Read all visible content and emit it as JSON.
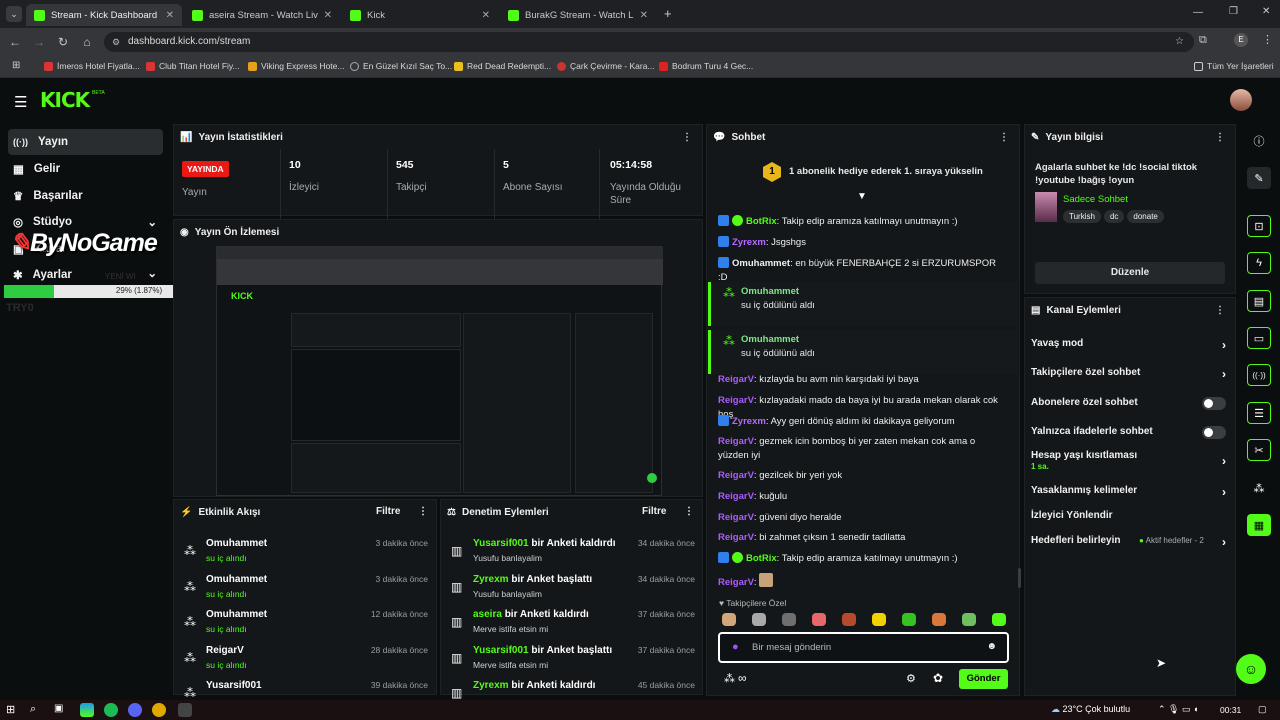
{
  "browser": {
    "tabs": [
      {
        "title": "Stream - Kick Dashboard"
      },
      {
        "title": "aseira Stream - Watch Live on K"
      },
      {
        "title": "Kick"
      },
      {
        "title": "BurakG Stream - Watch Live on"
      }
    ],
    "url": "dashboard.kick.com/stream",
    "bookmarks": [
      "İmeros Hotel Fiyatla...",
      "Club Titan Hotel Fiy...",
      "Viking Express Hote...",
      "En Güzel Kızıl Saç To...",
      "Red Dead Redempti...",
      "Çark Çevirme - Kara...",
      "Bodrum Turu 4 Gec..."
    ],
    "all_bookmarks": "Tüm Yer İşaretleri"
  },
  "kick": {
    "logo": "KICK",
    "beta": "BETA"
  },
  "sidebar": {
    "items": [
      {
        "label": "Yayın"
      },
      {
        "label": "Gelir"
      },
      {
        "label": "Başarılar"
      },
      {
        "label": "Stüdyo"
      },
      {
        "label": "Kanal"
      },
      {
        "label": "Ayarlar"
      }
    ],
    "watermark": "ByNoGame",
    "watermark_sub": "YENİ WI",
    "progress": {
      "label": "29% (1.87%)",
      "fraction": 0.0187
    },
    "ghost_text": "TRY0"
  },
  "stats": {
    "title": "Yayın İstatistikleri",
    "live_badge": "YAYINDA",
    "live_label": "Yayın",
    "viewers": {
      "value": "10",
      "label": "İzleyici"
    },
    "followers": {
      "value": "545",
      "label": "Takipçi"
    },
    "subs": {
      "value": "5",
      "label": "Abone Sayısı"
    },
    "uptime": {
      "value": "05:14:58",
      "label": "Yayında Olduğu Süre"
    }
  },
  "preview": {
    "title": "Yayın Ön İzlemesi"
  },
  "activity": {
    "title": "Etkinlik Akışı",
    "filter": "Filtre",
    "items": [
      {
        "name": "Omuhammet",
        "sub": "su iç alındı",
        "time": "3 dakika önce"
      },
      {
        "name": "Omuhammet",
        "sub": "su iç alındı",
        "time": "3 dakika önce"
      },
      {
        "name": "Omuhammet",
        "sub": "su iç alındı",
        "time": "12 dakika önce"
      },
      {
        "name": "ReigarV",
        "sub": "su iç alındı",
        "time": "28 dakika önce"
      },
      {
        "name": "Yusarsif001",
        "sub": "",
        "time": "39 dakika önce"
      }
    ]
  },
  "moderation": {
    "title": "Denetim Eylemleri",
    "filter": "Filtre",
    "items": [
      {
        "user": "Yusarsif001",
        "action": "bir Anketi kaldırdı",
        "sub": "Yusufu banlayalim",
        "time": "34 dakika önce"
      },
      {
        "user": "Zyrexm",
        "action": "bir Anket başlattı",
        "sub": "Yusufu banlayalim",
        "time": "34 dakika önce"
      },
      {
        "user": "aseira",
        "action": "bir Anketi kaldırdı",
        "sub": "Merve istifa etsin mi",
        "time": "37 dakika önce"
      },
      {
        "user": "Yusarsif001",
        "action": "bir Anket başlattı",
        "sub": "Merve istifa etsin mi",
        "time": "37 dakika önce"
      },
      {
        "user": "Zyrexm",
        "action": "bir Anketi kaldırdı",
        "sub": "",
        "time": "45 dakika önce"
      }
    ]
  },
  "chat": {
    "title": "Sohbet",
    "pinned": "1 abonelik hediye ederek 1. sıraya yükselin",
    "pinned_rank": "1",
    "messages": [
      {
        "user": "BotRix",
        "text": "Takip edip aramıza katılmayı unutmayın :)"
      },
      {
        "user": "Zyrexm",
        "text": "Jsgshgs"
      },
      {
        "user": "Omuhammet",
        "text": "en büyük FENERBAHÇE 2 si ERZURUMSPOR :D"
      }
    ],
    "rewards": [
      {
        "user": "Omuhammet",
        "text": "su iç ödülünü aldı"
      },
      {
        "user": "Omuhammet",
        "text": "su iç ödülünü aldı"
      }
    ],
    "messages2": [
      {
        "user": "ReigarV",
        "text": "kızlayda bu avm nin karşıdaki iyi baya"
      },
      {
        "user": "ReigarV",
        "text": "kızlayadaki mado da baya iyi bu arada mekan olarak cok hoş"
      },
      {
        "user": "Zyrexm",
        "text": "Ayy geri dönüş aldım iki dakikaya geliyorum"
      },
      {
        "user": "ReigarV",
        "text": "gezmek icin bomboş bi yer zaten mekan cok ama o yüzden iyi"
      },
      {
        "user": "ReigarV",
        "text": "gezilcek bir yeri yok"
      },
      {
        "user": "ReigarV",
        "text": "kuğulu"
      },
      {
        "user": "ReigarV",
        "text": "güveni diyo heralde"
      },
      {
        "user": "ReigarV",
        "text": "bi zahmet çıksın 1 senedir tadilatta"
      },
      {
        "user": "BotRix",
        "text": "Takip edip aramıza katılmayı unutmayın :)"
      },
      {
        "user": "ReigarV",
        "text": ""
      }
    ],
    "emote_section": "Takipçilere Özel",
    "input_placeholder": "Bir mesaj gönderin",
    "send": "Gönder",
    "infinity": "∞"
  },
  "info": {
    "title": "Yayın bilgisi",
    "stream_title": "Agalarla suhbet ke !dc !social tiktok !youtube !bağış !oyun",
    "category": "Sadece Sohbet",
    "tags": [
      "Turkish",
      "dc",
      "donate"
    ],
    "edit": "Düzenle"
  },
  "channel_actions": {
    "title": "Kanal Eylemleri",
    "items": [
      {
        "label": "Yavaş mod",
        "kind": "chevron"
      },
      {
        "label": "Takipçilere özel sohbet",
        "kind": "chevron"
      },
      {
        "label": "Abonelere özel sohbet",
        "kind": "toggle"
      },
      {
        "label": "Yalnızca ifadelerle sohbet",
        "kind": "toggle"
      },
      {
        "label": "Hesap yaşı kısıtlaması",
        "kind": "chevron",
        "sub": "1 sa."
      },
      {
        "label": "Yasaklanmış kelimeler",
        "kind": "chevron"
      },
      {
        "label": "İzleyici Yönlendir",
        "kind": "none"
      },
      {
        "label": "Hedefleri belirleyin",
        "kind": "chevron",
        "extra": "Aktif hedefler - 2"
      }
    ]
  },
  "taskbar": {
    "weather": "23°C  Çok bulutlu",
    "time": "00:31"
  },
  "colors": {
    "accent": "#53fc18",
    "live": "#e91916",
    "bg": "#0b0e0f",
    "panel": "#141719"
  }
}
